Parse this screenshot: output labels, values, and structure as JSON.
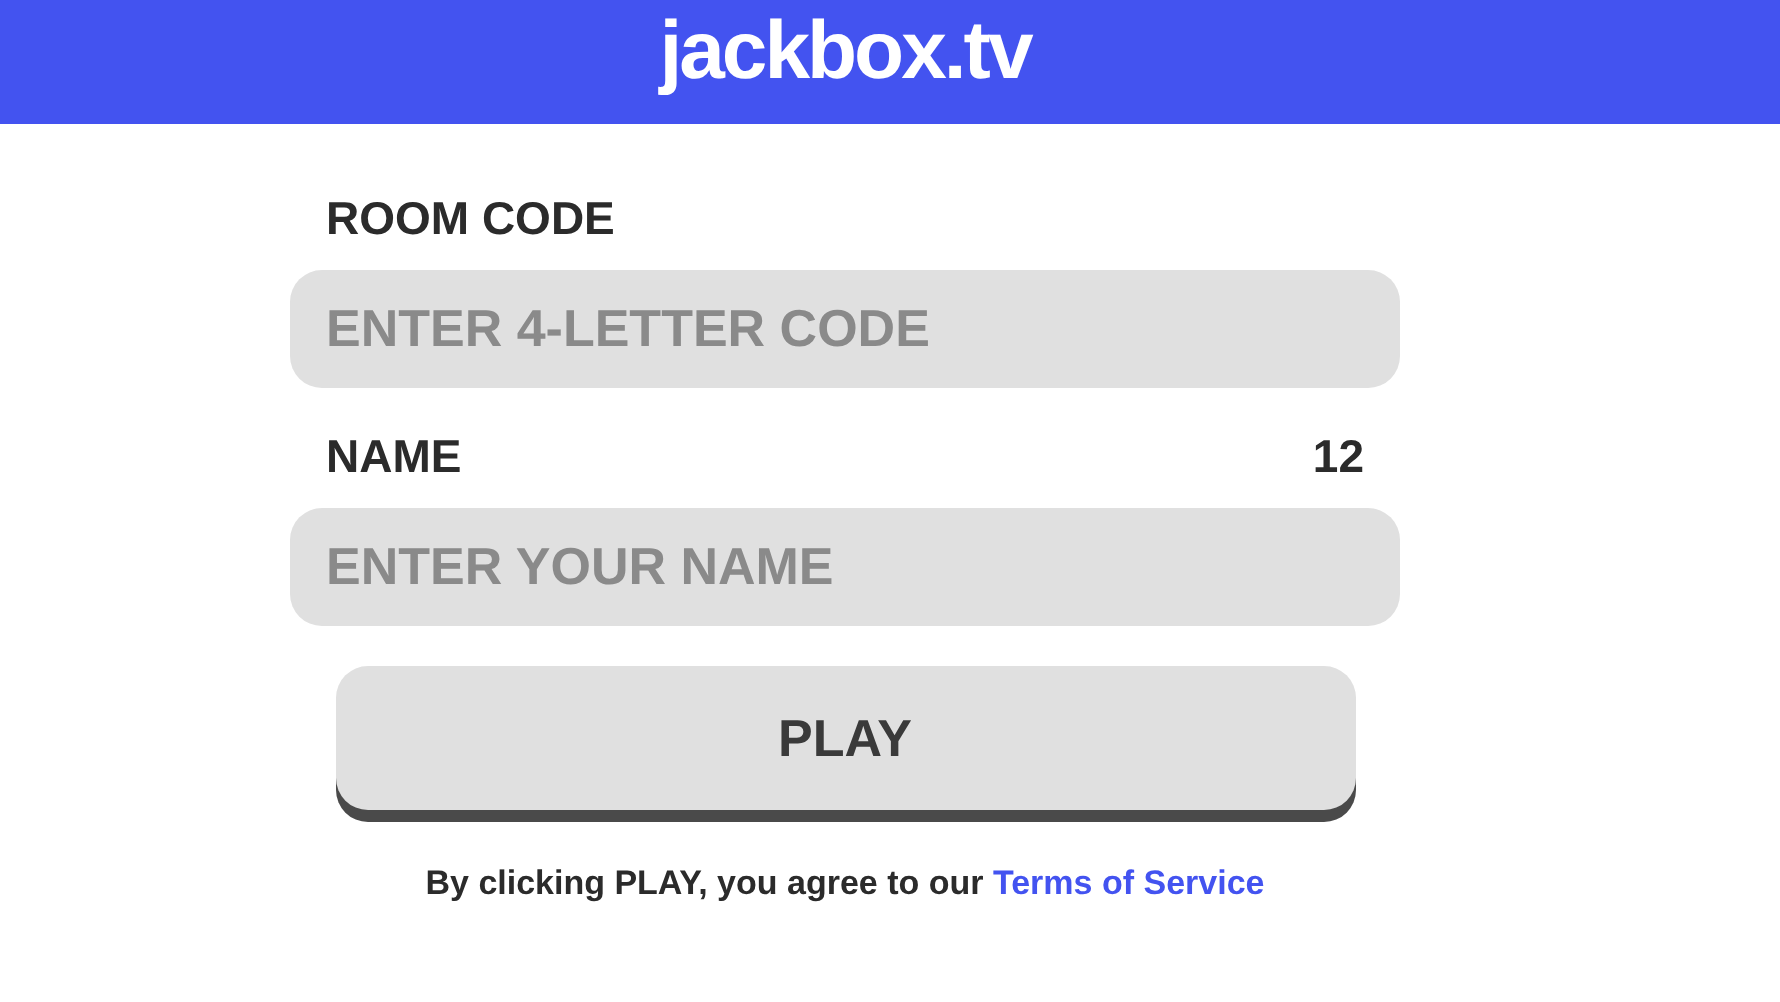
{
  "header": {
    "logo": "jackbox.tv"
  },
  "fields": [
    {
      "label": "ROOM CODE",
      "placeholder": "ENTER 4-LETTER CODE"
    },
    {
      "label": "NAME",
      "counter": "12",
      "placeholder": "ENTER YOUR NAME"
    }
  ],
  "play_button": "PLAY",
  "terms": {
    "text": "By clicking PLAY, you agree to our",
    "link": "Terms of Service"
  }
}
